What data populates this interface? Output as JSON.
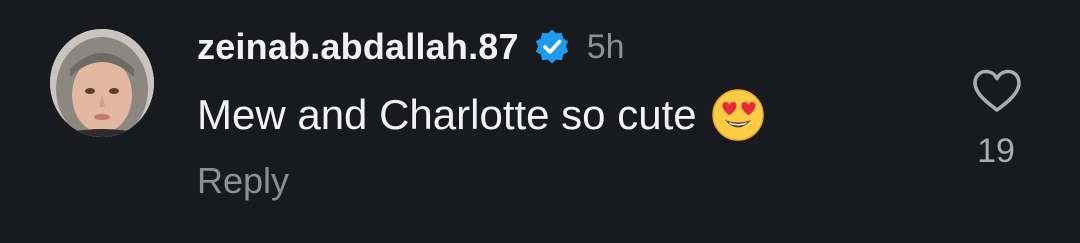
{
  "comment": {
    "username": "zeinab.abdallah.87",
    "verified": true,
    "timestamp": "5h",
    "text": "Mew and Charlotte so cute",
    "emoji": "smiling-face-with-heart-eyes",
    "reply_label": "Reply",
    "like_count": "19",
    "like_icon": "heart-outline-icon",
    "verified_icon": "verified-badge-icon"
  },
  "colors": {
    "background": "#181a1f",
    "text_primary": "#f2f2f2",
    "text_secondary": "#8c8f94",
    "verified_blue": "#1d9bf0"
  }
}
